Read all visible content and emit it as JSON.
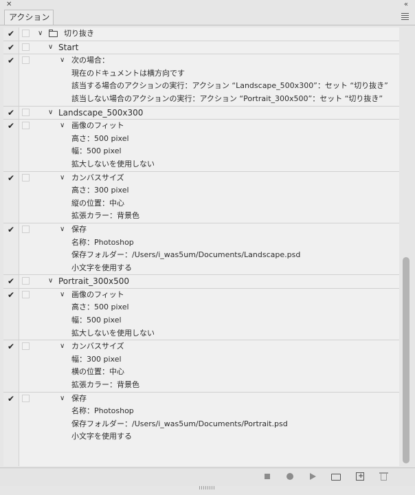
{
  "panel": {
    "tab_label": "アクション",
    "icons": {
      "close": "close-icon",
      "collapse": "collapse-icon",
      "menu": "panel-menu-icon"
    }
  },
  "rows": [
    {
      "level": 0,
      "check": "✔",
      "twist": "∨",
      "icon": "folder-icon",
      "label": "切り抜き"
    },
    {
      "level": 1,
      "check": "✔",
      "twist": "∨",
      "label": "Start",
      "sep": true
    },
    {
      "level": 2,
      "check": "✔",
      "twist": "∨",
      "label": "次の場合：",
      "sep": true
    },
    {
      "level": 3,
      "label": "現在のドキュメントは横方向です"
    },
    {
      "level": 3,
      "label": "該当する場合のアクションの実行：アクション “Landscape_500x300”：セット “切り抜き”"
    },
    {
      "level": 3,
      "label": "該当しない場合のアクションの実行：アクション “Portrait_300x500”：セット “切り抜き”"
    },
    {
      "level": 1,
      "check": "✔",
      "twist": "∨",
      "label": "Landscape_500x300",
      "sep": true
    },
    {
      "level": 2,
      "check": "✔",
      "twist": "∨",
      "label": "画像のフィット",
      "sep": true
    },
    {
      "level": 3,
      "label": "高さ：500 pixel"
    },
    {
      "level": 3,
      "label": "幅：500 pixel"
    },
    {
      "level": 3,
      "label": "拡大しないを使用しない"
    },
    {
      "level": 2,
      "check": "✔",
      "twist": "∨",
      "label": "カンバスサイズ",
      "sep": true
    },
    {
      "level": 3,
      "label": "高さ：300 pixel"
    },
    {
      "level": 3,
      "label": "縦の位置：中心"
    },
    {
      "level": 3,
      "label": "拡張カラー：背景色"
    },
    {
      "level": 2,
      "check": "✔",
      "twist": "∨",
      "label": "保存",
      "sep": true
    },
    {
      "level": 3,
      "label": "名称：Photoshop"
    },
    {
      "level": 3,
      "label": "保存フォルダー：/Users/i_was5um/Documents/Landscape.psd"
    },
    {
      "level": 3,
      "label": "小文字を使用する"
    },
    {
      "level": 1,
      "check": "✔",
      "twist": "∨",
      "label": "Portrait_300x500",
      "sep": true
    },
    {
      "level": 2,
      "check": "✔",
      "twist": "∨",
      "label": "画像のフィット",
      "sep": true
    },
    {
      "level": 3,
      "label": "高さ：500 pixel"
    },
    {
      "level": 3,
      "label": "幅：500 pixel"
    },
    {
      "level": 3,
      "label": "拡大しないを使用しない"
    },
    {
      "level": 2,
      "check": "✔",
      "twist": "∨",
      "label": "カンバスサイズ",
      "sep": true
    },
    {
      "level": 3,
      "label": "幅：300 pixel"
    },
    {
      "level": 3,
      "label": "横の位置：中心"
    },
    {
      "level": 3,
      "label": "拡張カラー：背景色"
    },
    {
      "level": 2,
      "check": "✔",
      "twist": "∨",
      "label": "保存",
      "sep": true
    },
    {
      "level": 3,
      "label": "名称：Photoshop"
    },
    {
      "level": 3,
      "label": "保存フォルダー：/Users/i_was5um/Documents/Portrait.psd"
    },
    {
      "level": 3,
      "label": "小文字を使用する"
    }
  ],
  "toolbar": {
    "buttons": [
      "stop-icon",
      "record-icon",
      "play-icon",
      "new-set-folder-icon",
      "new-action-icon",
      "trash-icon"
    ]
  },
  "colors": {
    "panel_bg": "#e6e6e6",
    "list_bg": "#f0f0f0",
    "scroll_thumb": "#b4b4b4"
  }
}
